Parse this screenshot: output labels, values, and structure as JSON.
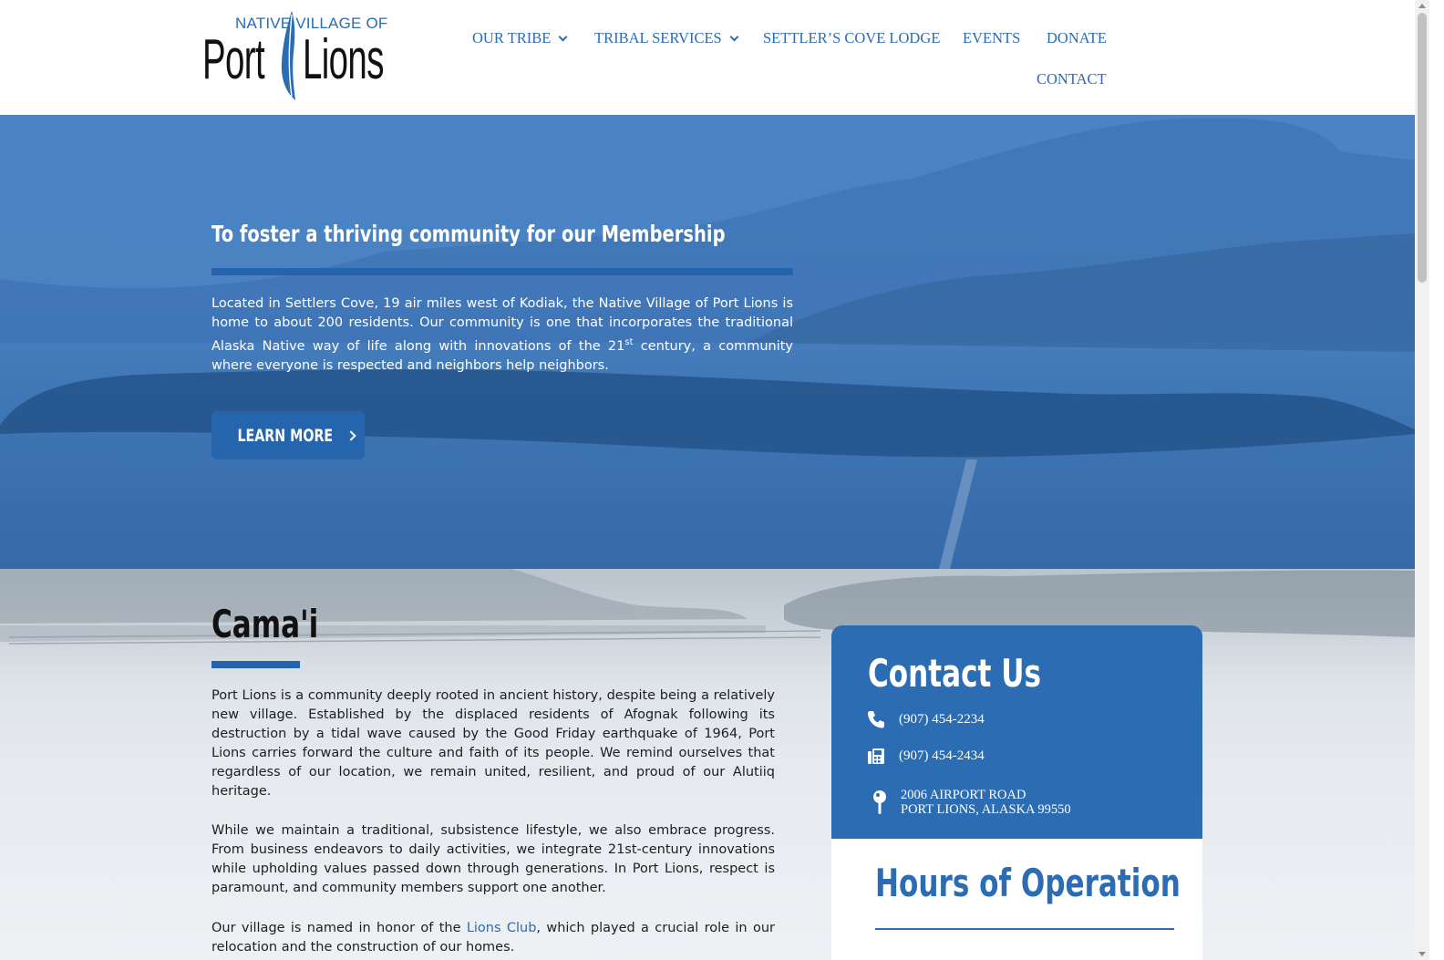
{
  "logo": {
    "top_line": "NATIVE VILLAGE OF",
    "left_word": "Port",
    "right_word": "Lions"
  },
  "nav": {
    "items": [
      {
        "label": "OUR TRIBE",
        "has_dropdown": true
      },
      {
        "label": "TRIBAL SERVICES",
        "has_dropdown": true
      },
      {
        "label": "SETTLER’S COVE LODGE",
        "has_dropdown": false
      },
      {
        "label": "EVENTS",
        "has_dropdown": false
      },
      {
        "label": "DONATE",
        "has_dropdown": false
      },
      {
        "label": "CONTACT",
        "has_dropdown": false
      }
    ]
  },
  "hero": {
    "title": "To foster a thriving community for our Membership",
    "text_before_sup": "Located in Settlers Cove, 19 air miles west of Kodiak, the Native Village of Port Lions is home to about 200 residents. Our community is one that incorporates the traditional Alaska Native way of life along with innovations of the 21",
    "sup": "st",
    "text_after_sup": " century, a community where everyone is respected and neighbors help neighbors.",
    "button_label": "LEARN MORE"
  },
  "camai": {
    "title": "Cama'i",
    "p1": "Port Lions is a community deeply rooted in ancient history, despite being a relatively new village. Established by the displaced residents of Afognak following its destruction by a tidal wave caused by the Good Friday earthquake of 1964, Port Lions carries forward the culture and faith of its people. We remind ourselves that regardless of our location, we remain united, resilient, and proud of our Alutiiq heritage.",
    "p2": "While we maintain a traditional, subsistence lifestyle, we also embrace progress. From business endeavors to daily activities, we integrate 21st-century innovations while upholding values passed down through generations. In Port Lions, respect is paramount, and community members support one another.",
    "p3_before_link": "Our village is named in honor of the ",
    "p3_link": "Lions Club",
    "p3_after_link": ", which played a crucial role in our relocation and the construction of our homes."
  },
  "contact": {
    "title": "Contact Us",
    "phone": "(907) 454-2234",
    "fax": "(907) 454-2434",
    "address_line1": "2006 AIRPORT ROAD",
    "address_line2": "PORT LIONS, ALASKA 99550"
  },
  "hours": {
    "title": "Hours of Operation"
  },
  "colors": {
    "brand_blue": "#2b6cb3",
    "hero_overlay": "#4a84c4",
    "accent_bar": "#2563ad"
  }
}
